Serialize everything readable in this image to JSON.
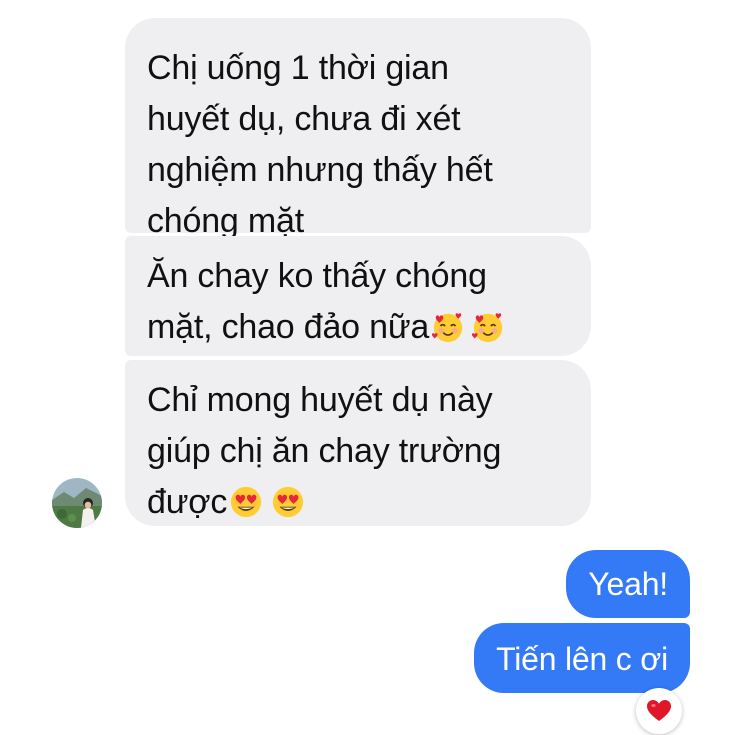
{
  "conversation": {
    "incoming": [
      {
        "line1": "Chị uống 1 thời gian",
        "line2": "huyết dụ, chưa đi xét",
        "line3": "nghiệm nhưng thấy hết",
        "line4": "chóng mặt"
      },
      {
        "line1": "Ăn chay ko thấy chóng",
        "line2": "mặt, chao đảo nữa"
      },
      {
        "line1": "Chỉ mong huyết dụ này",
        "line2": "giúp chị ăn chay trường",
        "line3": "được"
      }
    ],
    "outgoing": [
      {
        "text": "Yeah!"
      },
      {
        "text": "Tiến lên c ơi"
      }
    ]
  },
  "icons": {
    "bubble_2_emoji": "smiling-face-with-hearts-emoji",
    "bubble_3_emoji": "heart-eyes-emoji",
    "reaction": "red-heart-icon",
    "avatar": "profile-photo"
  },
  "colors": {
    "incoming_bubble": "#efeff1",
    "outgoing_bubble": "#3479f5",
    "reaction_heart": "#e0162b"
  }
}
